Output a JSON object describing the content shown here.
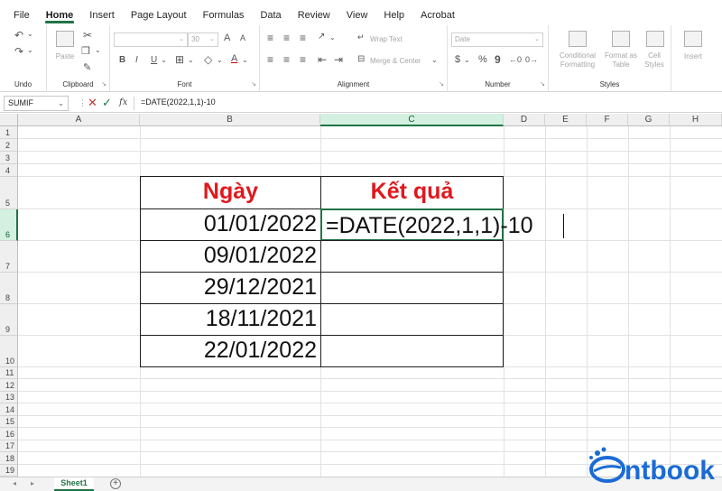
{
  "menu": {
    "items": [
      "File",
      "Home",
      "Insert",
      "Page Layout",
      "Formulas",
      "Data",
      "Review",
      "View",
      "Help",
      "Acrobat"
    ],
    "active": "Home"
  },
  "ribbon": {
    "undo": {
      "label": "Undo"
    },
    "clipboard": {
      "label": "Clipboard",
      "paste": "Paste"
    },
    "font": {
      "label": "Font",
      "size": "30",
      "bold": "B",
      "italic": "I",
      "underline": "U",
      "grow": "A",
      "shrink": "A",
      "font_color": "A"
    },
    "alignment": {
      "label": "Alignment",
      "wrap_text": "Wrap Text",
      "merge_center": "Merge & Center"
    },
    "number": {
      "label": "Number",
      "format": "Date",
      "currency": "$",
      "percent": "%",
      "comma": "9"
    },
    "styles": {
      "label": "Styles",
      "conditional": [
        "Conditional",
        "Formatting"
      ],
      "format_as": [
        "Format as",
        "Table"
      ],
      "cell_styles": [
        "Cell",
        "Styles"
      ]
    },
    "insert": {
      "label": "Insert"
    }
  },
  "formula_bar": {
    "name_box": "SUMIF",
    "formula": "=DATE(2022,1,1)-10",
    "fx": "fx"
  },
  "grid": {
    "columns": [
      "A",
      "B",
      "C",
      "D",
      "E",
      "F",
      "G",
      "H"
    ],
    "selected_column": "C",
    "rows": [
      "1",
      "2",
      "3",
      "4",
      "5",
      "6",
      "7",
      "8",
      "9",
      "10",
      "11",
      "12",
      "13",
      "14",
      "15",
      "16",
      "17",
      "18",
      "19"
    ],
    "selected_row": "6",
    "header_left": "Ngày",
    "header_right": "Kết quả",
    "dates": [
      "01/01/2022",
      "09/01/2022",
      "29/12/2021",
      "18/11/2021",
      "22/01/2022"
    ],
    "editing_cell_value": "=DATE(2022,1,1)-10"
  },
  "sheets": {
    "tabs": [
      "Sheet1"
    ],
    "add": "+"
  },
  "watermark": {
    "text": "ntbook",
    "color": "#1b6bd6"
  }
}
